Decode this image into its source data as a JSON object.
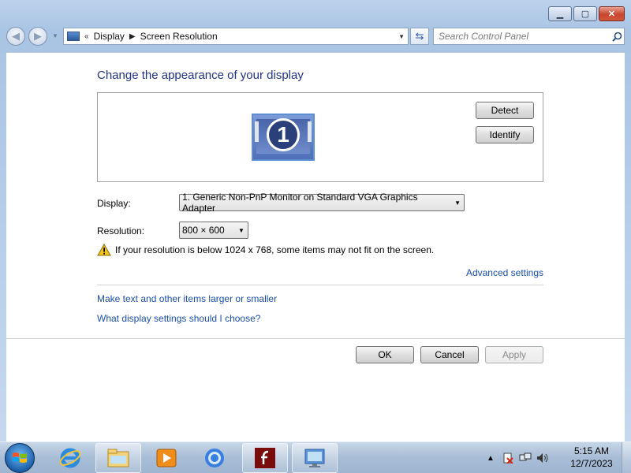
{
  "window": {
    "caption_buttons": [
      "minimize",
      "maximize",
      "close"
    ]
  },
  "address": {
    "overflow_glyph": "«",
    "breadcrumb": [
      "Display",
      "Screen Resolution"
    ],
    "search_placeholder": "Search Control Panel"
  },
  "page": {
    "title": "Change the appearance of your display",
    "monitor_number": "1",
    "detect_label": "Detect",
    "identify_label": "Identify"
  },
  "display": {
    "label": "Display:",
    "value": "1. Generic Non-PnP Monitor on Standard VGA Graphics Adapter"
  },
  "resolution": {
    "label": "Resolution:",
    "value": "800 × 600"
  },
  "warning": {
    "text": "If your resolution is below 1024 x 768, some items may not fit on the screen."
  },
  "links": {
    "advanced": "Advanced settings",
    "larger": "Make text and other items larger or smaller",
    "which": "What display settings should I choose?"
  },
  "buttons": {
    "ok": "OK",
    "cancel": "Cancel",
    "apply": "Apply"
  },
  "taskbar": {
    "items": [
      "start-orb",
      "internet-explorer-icon",
      "windows-explorer-icon",
      "media-player-icon",
      "chrome-icon",
      "flash-icon",
      "control-panel-icon"
    ],
    "clock_time": "5:15 AM",
    "clock_date": "12/7/2023"
  },
  "colors": {
    "title_blue": "#1e3287",
    "link_blue": "#1a4fa8",
    "taskbar": "#a8bdd6"
  }
}
